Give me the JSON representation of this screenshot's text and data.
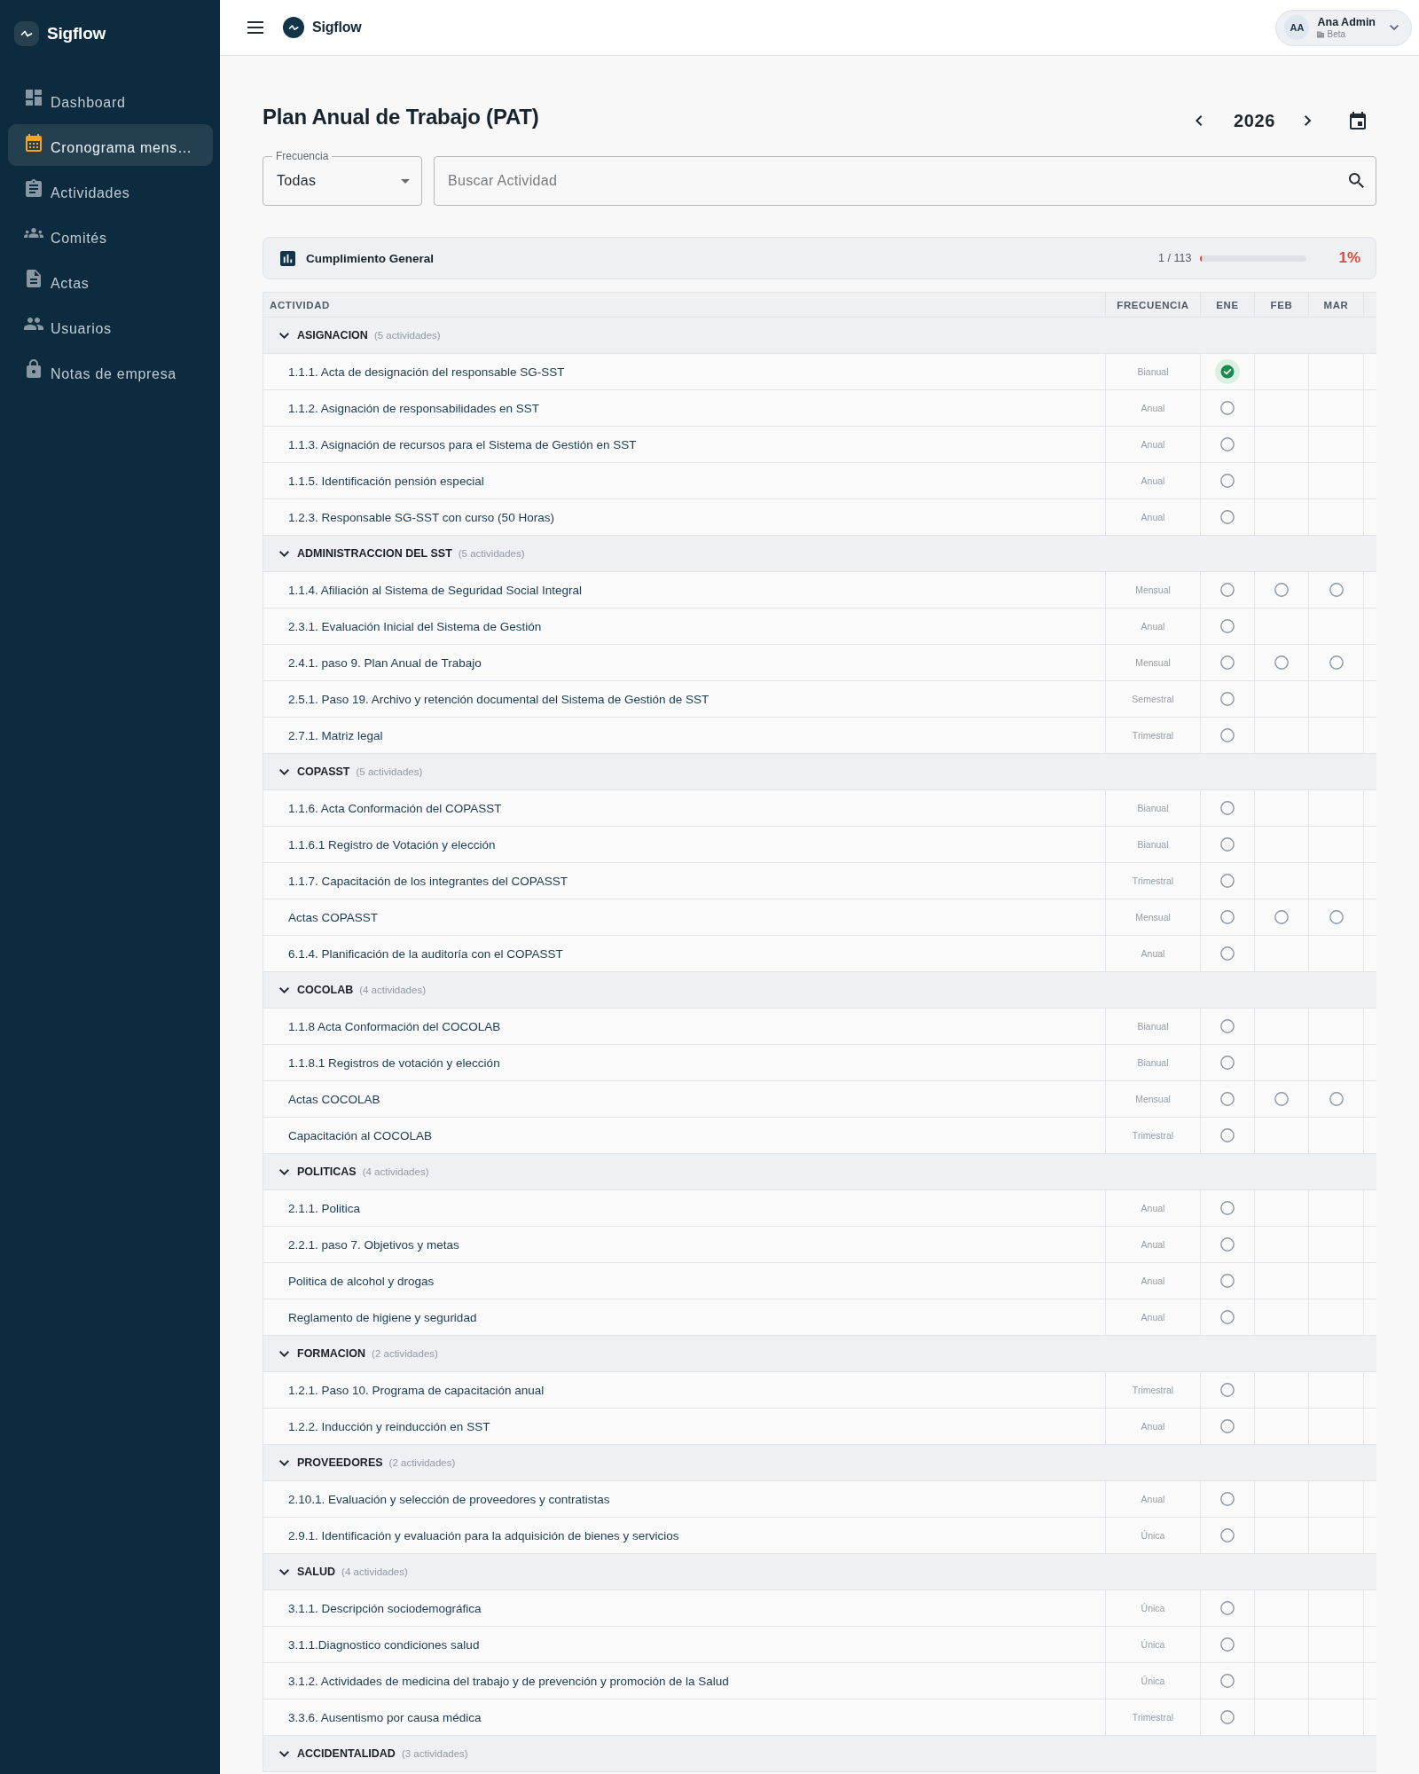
{
  "sidebar": {
    "brand": "Sigflow",
    "items": [
      {
        "label": "Dashboard",
        "selected": false
      },
      {
        "label": "Cronograma mens…",
        "selected": true
      },
      {
        "label": "Actividades",
        "selected": false
      },
      {
        "label": "Comités",
        "selected": false
      },
      {
        "label": "Actas",
        "selected": false
      },
      {
        "label": "Usuarios",
        "selected": false
      },
      {
        "label": "Notas de empresa",
        "selected": false
      }
    ]
  },
  "topbar": {
    "brand": "Sigflow",
    "user": {
      "initials": "AA",
      "name": "Ana Admin",
      "company": "Beta"
    }
  },
  "page": {
    "title": "Plan Anual de Trabajo (PAT)",
    "year": "2026"
  },
  "filters": {
    "frequency": {
      "label": "Frecuencia",
      "value": "Todas"
    },
    "search": {
      "placeholder": "Buscar Actividad"
    }
  },
  "summary": {
    "title": "Cumplimiento General",
    "count": "1 / 113",
    "level": 0.01,
    "percent": "1%"
  },
  "table": {
    "columns": [
      "ACTIVIDAD",
      "FRECUENCIA",
      "ENE",
      "FEB",
      "MAR"
    ],
    "groups": [
      {
        "name": "ASIGNACION",
        "count": "(5 actividades)",
        "expanded": true,
        "rows": [
          {
            "activity": "1.1.1. Acta de designación del responsable SG-SST",
            "frequency": "Bianual",
            "scheduled": [
              true,
              false,
              false
            ],
            "checked": [
              true,
              false,
              false
            ]
          },
          {
            "activity": "1.1.2. Asignación de responsabilidades en SST",
            "frequency": "Anual",
            "scheduled": [
              true,
              false,
              false
            ],
            "checked": [
              false,
              false,
              false
            ]
          },
          {
            "activity": "1.1.3. Asignación de recursos para el Sistema de Gestión en SST",
            "frequency": "Anual",
            "scheduled": [
              true,
              false,
              false
            ],
            "checked": [
              false,
              false,
              false
            ]
          },
          {
            "activity": "1.1.5. Identificación pensión especial",
            "frequency": "Anual",
            "scheduled": [
              true,
              false,
              false
            ],
            "checked": [
              false,
              false,
              false
            ]
          },
          {
            "activity": "1.2.3. Responsable SG-SST con curso (50 Horas)",
            "frequency": "Anual",
            "scheduled": [
              true,
              false,
              false
            ],
            "checked": [
              false,
              false,
              false
            ]
          }
        ]
      },
      {
        "name": "ADMINISTRACCION DEL SST",
        "count": "(5 actividades)",
        "expanded": true,
        "rows": [
          {
            "activity": "1.1.4. Afiliación al Sistema de Seguridad Social Integral",
            "frequency": "Mensual",
            "scheduled": [
              true,
              true,
              true
            ],
            "checked": [
              false,
              false,
              false
            ]
          },
          {
            "activity": "2.3.1. Evaluación Inicial del Sistema de Gestión",
            "frequency": "Anual",
            "scheduled": [
              true,
              false,
              false
            ],
            "checked": [
              false,
              false,
              false
            ]
          },
          {
            "activity": "2.4.1. paso 9. Plan Anual de Trabajo",
            "frequency": "Mensual",
            "scheduled": [
              true,
              true,
              true
            ],
            "checked": [
              false,
              false,
              false
            ]
          },
          {
            "activity": "2.5.1. Paso 19. Archivo y retención documental del Sistema de Gestión de SST",
            "frequency": "Semestral",
            "scheduled": [
              true,
              false,
              false
            ],
            "checked": [
              false,
              false,
              false
            ]
          },
          {
            "activity": "2.7.1. Matriz legal",
            "frequency": "Trimestral",
            "scheduled": [
              true,
              false,
              false
            ],
            "checked": [
              false,
              false,
              false
            ]
          }
        ]
      },
      {
        "name": "COPASST",
        "count": "(5 actividades)",
        "expanded": true,
        "rows": [
          {
            "activity": "1.1.6. Acta Conformación del COPASST",
            "frequency": "Bianual",
            "scheduled": [
              true,
              false,
              false
            ],
            "checked": [
              false,
              false,
              false
            ]
          },
          {
            "activity": "1.1.6.1 Registro de Votación y elección",
            "frequency": "Bianual",
            "scheduled": [
              true,
              false,
              false
            ],
            "checked": [
              false,
              false,
              false
            ]
          },
          {
            "activity": "1.1.7. Capacitación de los integrantes del COPASST",
            "frequency": "Trimestral",
            "scheduled": [
              true,
              false,
              false
            ],
            "checked": [
              false,
              false,
              false
            ]
          },
          {
            "activity": "Actas COPASST",
            "frequency": "Mensual",
            "scheduled": [
              true,
              true,
              true
            ],
            "checked": [
              false,
              false,
              false
            ]
          },
          {
            "activity": "6.1.4. Planificación de la auditoría con el COPASST",
            "frequency": "Anual",
            "scheduled": [
              true,
              false,
              false
            ],
            "checked": [
              false,
              false,
              false
            ]
          }
        ]
      },
      {
        "name": "COCOLAB",
        "count": "(4 actividades)",
        "expanded": true,
        "rows": [
          {
            "activity": "1.1.8 Acta Conformación del COCOLAB",
            "frequency": "Bianual",
            "scheduled": [
              true,
              false,
              false
            ],
            "checked": [
              false,
              false,
              false
            ]
          },
          {
            "activity": "1.1.8.1 Registros de votación y elección",
            "frequency": "Bianual",
            "scheduled": [
              true,
              false,
              false
            ],
            "checked": [
              false,
              false,
              false
            ]
          },
          {
            "activity": "Actas COCOLAB",
            "frequency": "Mensual",
            "scheduled": [
              true,
              true,
              true
            ],
            "checked": [
              false,
              false,
              false
            ]
          },
          {
            "activity": "Capacitación al COCOLAB",
            "frequency": "Trimestral",
            "scheduled": [
              true,
              false,
              false
            ],
            "checked": [
              false,
              false,
              false
            ]
          }
        ]
      },
      {
        "name": "POLITICAS",
        "count": "(4 actividades)",
        "expanded": true,
        "rows": [
          {
            "activity": "2.1.1. Politica",
            "frequency": "Anual",
            "scheduled": [
              true,
              false,
              false
            ],
            "checked": [
              false,
              false,
              false
            ]
          },
          {
            "activity": "2.2.1. paso 7. Objetivos y metas",
            "frequency": "Anual",
            "scheduled": [
              true,
              false,
              false
            ],
            "checked": [
              false,
              false,
              false
            ]
          },
          {
            "activity": "Politica de alcohol y drogas",
            "frequency": "Anual",
            "scheduled": [
              true,
              false,
              false
            ],
            "checked": [
              false,
              false,
              false
            ]
          },
          {
            "activity": "Reglamento de higiene y seguridad",
            "frequency": "Anual",
            "scheduled": [
              true,
              false,
              false
            ],
            "checked": [
              false,
              false,
              false
            ]
          }
        ]
      },
      {
        "name": "FORMACION",
        "count": "(2 actividades)",
        "expanded": true,
        "rows": [
          {
            "activity": "1.2.1. Paso 10. Programa de capacitación anual",
            "frequency": "Trimestral",
            "scheduled": [
              true,
              false,
              false
            ],
            "checked": [
              false,
              false,
              false
            ]
          },
          {
            "activity": "1.2.2. Inducción y reinducción en SST",
            "frequency": "Anual",
            "scheduled": [
              true,
              false,
              false
            ],
            "checked": [
              false,
              false,
              false
            ]
          }
        ]
      },
      {
        "name": "PROVEEDORES",
        "count": "(2 actividades)",
        "expanded": true,
        "rows": [
          {
            "activity": "2.10.1. Evaluación y selección de proveedores y contratistas",
            "frequency": "Anual",
            "scheduled": [
              true,
              false,
              false
            ],
            "checked": [
              false,
              false,
              false
            ]
          },
          {
            "activity": "2.9.1. Identificación y evaluación para la adquisición de bienes y servicios",
            "frequency": "Única",
            "scheduled": [
              true,
              false,
              false
            ],
            "checked": [
              false,
              false,
              false
            ]
          }
        ]
      },
      {
        "name": "SALUD",
        "count": "(4 actividades)",
        "expanded": true,
        "rows": [
          {
            "activity": "3.1.1. Descripción sociodemográfica",
            "frequency": "Única",
            "scheduled": [
              true,
              false,
              false
            ],
            "checked": [
              false,
              false,
              false
            ]
          },
          {
            "activity": "3.1.1.Diagnostico condiciones salud",
            "frequency": "Única",
            "scheduled": [
              true,
              false,
              false
            ],
            "checked": [
              false,
              false,
              false
            ]
          },
          {
            "activity": "3.1.2. Actividades de medicina del trabajo y de prevención y promoción de la Salud",
            "frequency": "Única",
            "scheduled": [
              true,
              false,
              false
            ],
            "checked": [
              false,
              false,
              false
            ]
          },
          {
            "activity": "3.3.6. Ausentismo por causa médica",
            "frequency": "Trimestral",
            "scheduled": [
              true,
              false,
              false
            ],
            "checked": [
              false,
              false,
              false
            ]
          }
        ]
      },
      {
        "name": "ACCIDENTALIDAD",
        "count": "(3 actividades)",
        "expanded": true
      }
    ]
  }
}
